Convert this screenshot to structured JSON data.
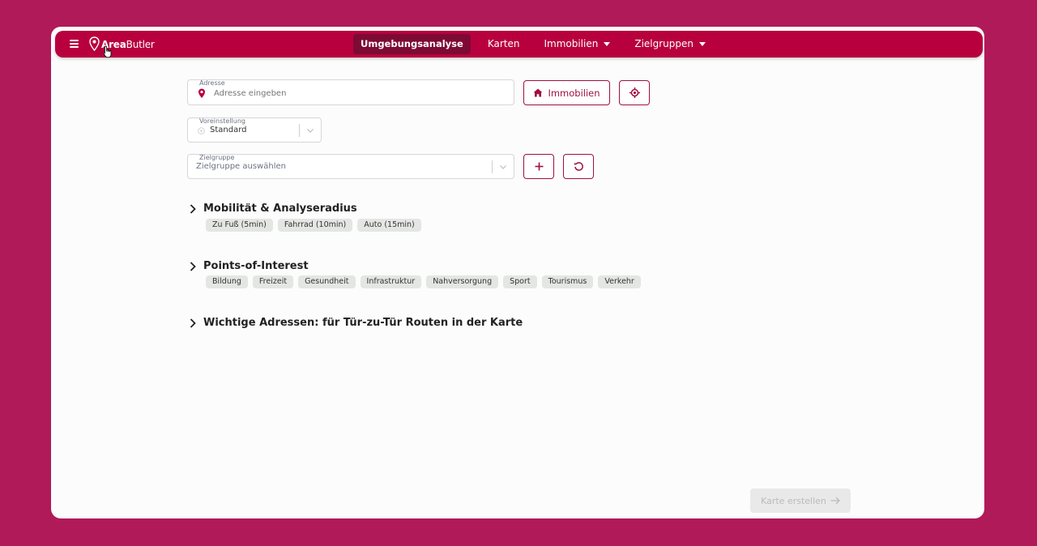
{
  "app": {
    "brand_bold": "Area",
    "brand_light": "Butler"
  },
  "nav": {
    "items": [
      {
        "label": "Umgebungsanalyse"
      },
      {
        "label": "Karten"
      },
      {
        "label": "Immobilien"
      },
      {
        "label": "Zielgruppen"
      }
    ]
  },
  "form": {
    "address": {
      "label": "Adresse",
      "placeholder": "Adresse eingeben"
    },
    "immobilien_button": "Immobilien",
    "preset": {
      "label": "Voreinstellung",
      "value": "Standard"
    },
    "target_group": {
      "label": "Zielgruppe",
      "placeholder": "Zielgruppe auswählen"
    }
  },
  "sections": {
    "mobility": {
      "title": "Mobilität & Analyseradius",
      "chips": [
        "Zu Fuß (5min)",
        "Fahrrad (10min)",
        "Auto (15min)"
      ]
    },
    "poi": {
      "title": "Points-of-Interest",
      "chips": [
        "Bildung",
        "Freizeit",
        "Gesundheit",
        "Infrastruktur",
        "Nahversorgung",
        "Sport",
        "Tourismus",
        "Verkehr"
      ]
    },
    "addresses": {
      "title": "Wichtige Adressen: für Tür-zu-Tür Routen in der Karte"
    }
  },
  "footer": {
    "submit_label": "Karte erstellen"
  },
  "colors": {
    "background": "#b01a58",
    "navbar": "#b8003f",
    "nav_active": "#7d0a33",
    "accent": "#a0103f"
  }
}
